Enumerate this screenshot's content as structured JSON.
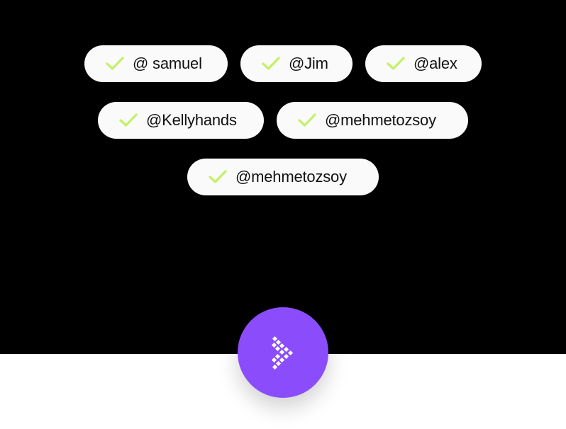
{
  "colors": {
    "background_top": "#000000",
    "background_bottom": "#ffffff",
    "chip_background": "#fafafa",
    "check_color": "#c4f16b",
    "fab_color": "#8b4dfc",
    "fab_icon_color": "#ffffff"
  },
  "chips": [
    {
      "label": "@ samuel",
      "icon": "check-icon",
      "selected": true
    },
    {
      "label": "@Jim",
      "icon": "check-icon",
      "selected": true
    },
    {
      "label": "@alex",
      "icon": "check-icon",
      "selected": true
    },
    {
      "label": "@Kellyhands",
      "icon": "check-icon",
      "selected": true
    },
    {
      "label": "@mehmetozsoy",
      "icon": "check-icon",
      "selected": true
    },
    {
      "label": "@mehmetozsoy",
      "icon": "check-icon",
      "selected": true
    }
  ],
  "fab": {
    "icon": "pixel-arrow-right-icon"
  }
}
